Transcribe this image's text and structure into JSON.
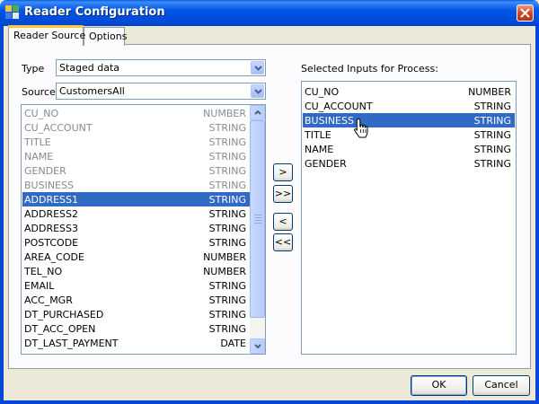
{
  "window": {
    "title": "Reader Configuration"
  },
  "tabs": [
    {
      "label": "Reader Source",
      "active": true
    },
    {
      "label": "Options",
      "active": false
    }
  ],
  "type_field": {
    "label": "Type",
    "value": "Staged data"
  },
  "source_field": {
    "label": "Source",
    "value": "CustomersAll"
  },
  "available": {
    "rows": [
      {
        "name": "CU_NO",
        "type": "NUMBER",
        "state": "dim"
      },
      {
        "name": "CU_ACCOUNT",
        "type": "STRING",
        "state": "dim"
      },
      {
        "name": "TITLE",
        "type": "STRING",
        "state": "dim"
      },
      {
        "name": "NAME",
        "type": "STRING",
        "state": "dim"
      },
      {
        "name": "GENDER",
        "type": "STRING",
        "state": "dim"
      },
      {
        "name": "BUSINESS",
        "type": "STRING",
        "state": "dim"
      },
      {
        "name": "ADDRESS1",
        "type": "STRING",
        "state": "selected"
      },
      {
        "name": "ADDRESS2",
        "type": "STRING",
        "state": "normal"
      },
      {
        "name": "ADDRESS3",
        "type": "STRING",
        "state": "normal"
      },
      {
        "name": "POSTCODE",
        "type": "STRING",
        "state": "normal"
      },
      {
        "name": "AREA_CODE",
        "type": "NUMBER",
        "state": "normal"
      },
      {
        "name": "TEL_NO",
        "type": "NUMBER",
        "state": "normal"
      },
      {
        "name": "EMAIL",
        "type": "STRING",
        "state": "normal"
      },
      {
        "name": "ACC_MGR",
        "type": "STRING",
        "state": "normal"
      },
      {
        "name": "DT_PURCHASED",
        "type": "STRING",
        "state": "normal"
      },
      {
        "name": "DT_ACC_OPEN",
        "type": "STRING",
        "state": "normal"
      },
      {
        "name": "DT_LAST_PAYMENT",
        "type": "DATE",
        "state": "normal"
      }
    ]
  },
  "move_buttons": {
    "add": ">",
    "add_all": ">>",
    "remove": "<",
    "remove_all": "<<"
  },
  "selected_inputs": {
    "label": "Selected Inputs for Process:",
    "rows": [
      {
        "name": "CU_NO",
        "type": "NUMBER",
        "state": "normal"
      },
      {
        "name": "CU_ACCOUNT",
        "type": "STRING",
        "state": "normal"
      },
      {
        "name": "BUSINESS",
        "type": "STRING",
        "state": "selected"
      },
      {
        "name": "TITLE",
        "type": "STRING",
        "state": "normal"
      },
      {
        "name": "NAME",
        "type": "STRING",
        "state": "normal"
      },
      {
        "name": "GENDER",
        "type": "STRING",
        "state": "normal"
      }
    ]
  },
  "footer": {
    "ok_label": "OK",
    "cancel_label": "Cancel"
  },
  "colors": {
    "selection": "#316ac5",
    "titlebar": "#0055e5",
    "dim_text": "#8a8a8a"
  }
}
